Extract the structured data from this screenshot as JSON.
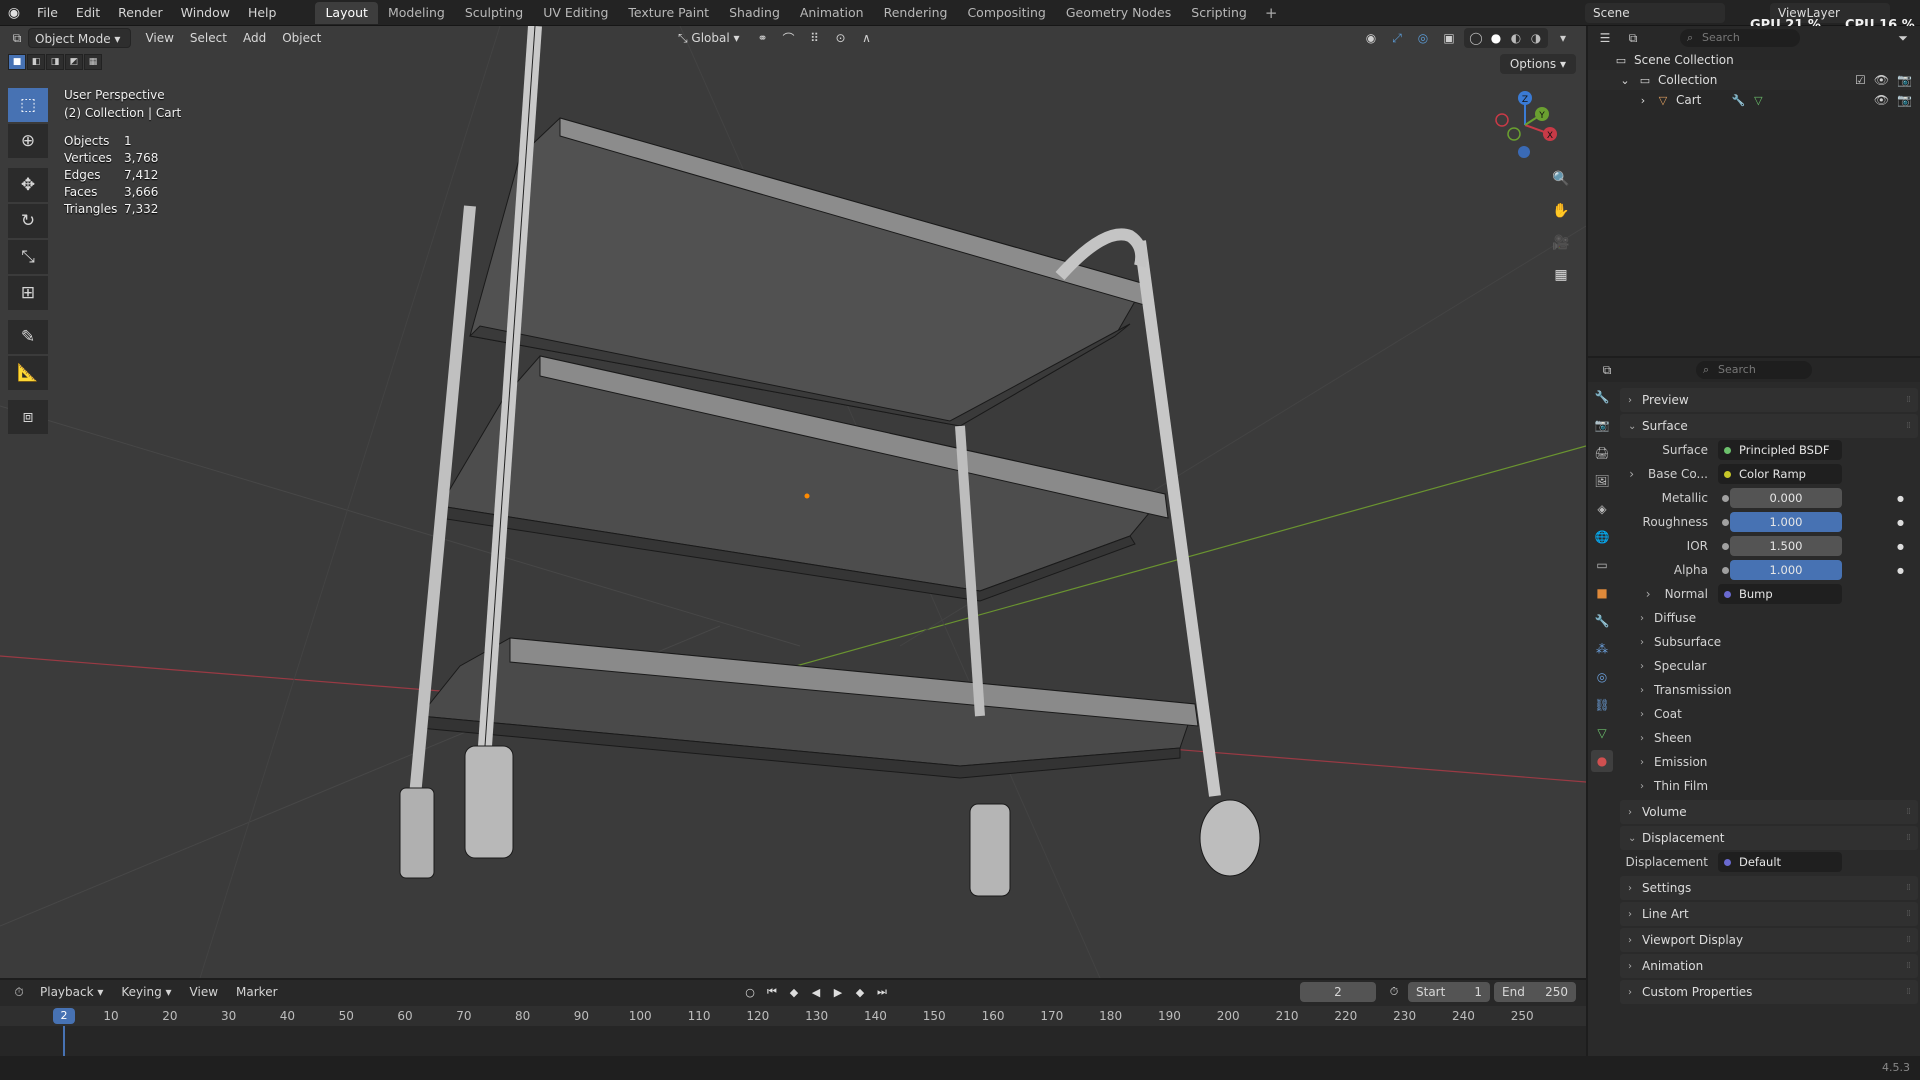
{
  "topbar": {
    "menus": [
      "File",
      "Edit",
      "Render",
      "Window",
      "Help"
    ],
    "workspaces": [
      "Layout",
      "Modeling",
      "Sculpting",
      "UV Editing",
      "Texture Paint",
      "Shading",
      "Animation",
      "Rendering",
      "Compositing",
      "Geometry Nodes",
      "Scripting"
    ],
    "active_workspace": "Layout",
    "scene": "Scene",
    "view_layer": "ViewLayer",
    "gpu": "GPU 21 %",
    "cpu": "CPU 16 %"
  },
  "viewport": {
    "mode": "Object Mode",
    "menus": [
      "View",
      "Select",
      "Add",
      "Object"
    ],
    "transform_orientation": "Global",
    "options": "Options",
    "perspective": "User Perspective",
    "collection_line": "(2) Collection | Cart",
    "stats": [
      {
        "label": "Objects",
        "value": "1"
      },
      {
        "label": "Vertices",
        "value": "3,768"
      },
      {
        "label": "Edges",
        "value": "7,412"
      },
      {
        "label": "Faces",
        "value": "3,666"
      },
      {
        "label": "Triangles",
        "value": "7,332"
      }
    ],
    "gizmo": {
      "x": "X",
      "y": "Y",
      "z": "Z"
    },
    "colors": {
      "x_axis": "#c83a47",
      "y_axis": "#6aa030",
      "z_axis": "#3a7bd5",
      "origin": "#ff8a00"
    }
  },
  "outliner": {
    "search_placeholder": "Search",
    "scene_collection": "Scene Collection",
    "collection": "Collection",
    "object": "Cart"
  },
  "properties": {
    "search_placeholder": "Search",
    "sections": {
      "preview": "Preview",
      "surface": "Surface",
      "volume": "Volume",
      "displacement": "Displacement",
      "settings": "Settings",
      "line_art": "Line Art",
      "viewport_display": "Viewport Display",
      "animation": "Animation",
      "custom_properties": "Custom Properties"
    },
    "surface_label": "Surface",
    "surface_value": "Principled BSDF",
    "base_color_label": "Base Co...",
    "base_color_value": "Color Ramp",
    "metallic_label": "Metallic",
    "metallic_value": "0.000",
    "roughness_label": "Roughness",
    "roughness_value": "1.000",
    "ior_label": "IOR",
    "ior_value": "1.500",
    "alpha_label": "Alpha",
    "alpha_value": "1.000",
    "normal_label": "Normal",
    "normal_value": "Bump",
    "subpanels": [
      "Diffuse",
      "Subsurface",
      "Specular",
      "Transmission",
      "Coat",
      "Sheen",
      "Emission",
      "Thin Film"
    ],
    "displacement_label": "Displacement",
    "displacement_value": "Default"
  },
  "timeline": {
    "menus": [
      "Playback",
      "Keying",
      "View",
      "Marker"
    ],
    "current_frame": "2",
    "start_label": "Start",
    "start_value": "1",
    "end_label": "End",
    "end_value": "250",
    "ticks": [
      "10",
      "20",
      "30",
      "40",
      "50",
      "60",
      "70",
      "80",
      "90",
      "100",
      "110",
      "120",
      "130",
      "140",
      "150",
      "160",
      "170",
      "180",
      "190",
      "200",
      "210",
      "220",
      "230",
      "240",
      "250"
    ]
  },
  "status": {
    "version": "4.5.3"
  }
}
